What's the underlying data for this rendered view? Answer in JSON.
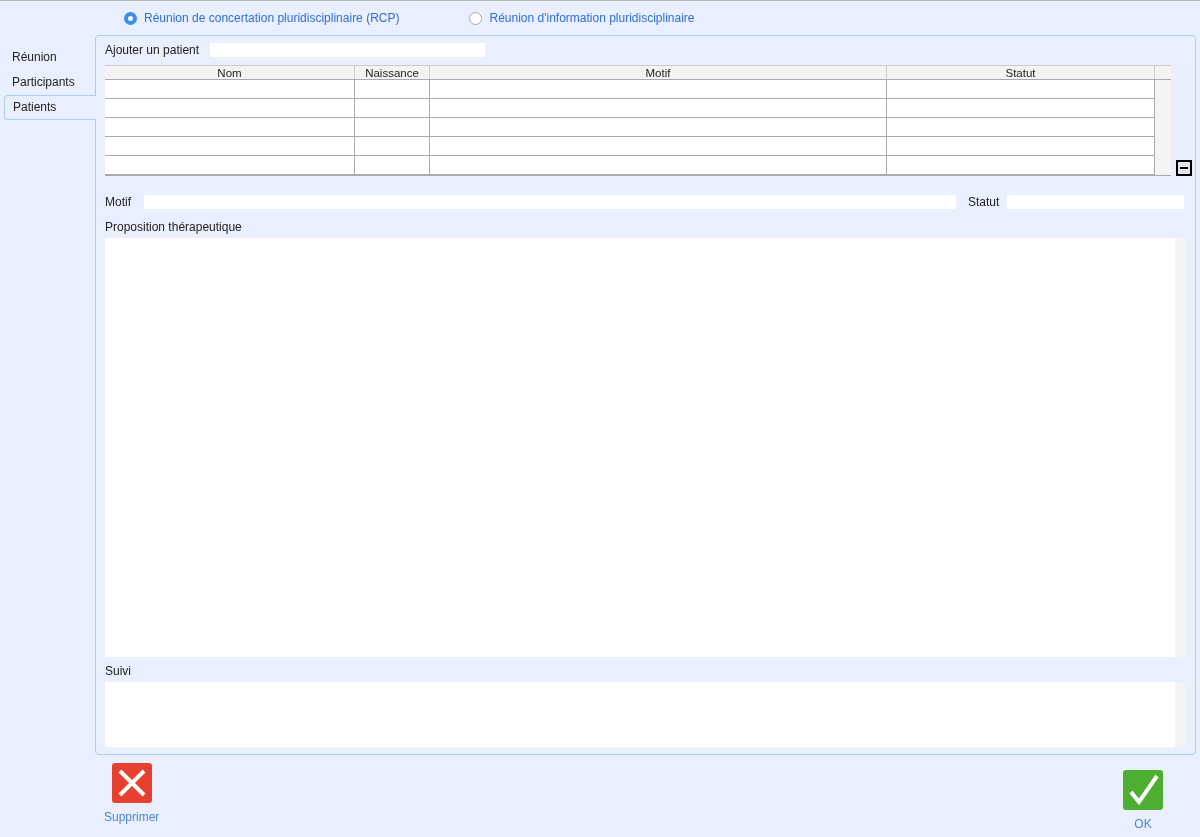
{
  "meeting_type": [
    {
      "label": "Réunion de concertation pluridisciplinaire (RCP)",
      "selected": true
    },
    {
      "label": "Réunion d'information pluridisciplinaire",
      "selected": false
    }
  ],
  "tabs": [
    {
      "label": "Réunion",
      "selected": false
    },
    {
      "label": "Participants",
      "selected": false
    },
    {
      "label": "Patients",
      "selected": true
    }
  ],
  "add_patient": {
    "label": "Ajouter un patient"
  },
  "table": {
    "columns": [
      "Nom",
      "Naissance",
      "Motif",
      "Statut"
    ]
  },
  "motif": {
    "label": "Motif"
  },
  "statut": {
    "label": "Statut"
  },
  "proposition": {
    "label": "Proposition thérapeutique"
  },
  "suivi": {
    "label": "Suivi"
  },
  "buttons": [
    {
      "kind": "delete",
      "label": "Supprimer"
    },
    {
      "kind": "ok",
      "label": "OK"
    }
  ]
}
